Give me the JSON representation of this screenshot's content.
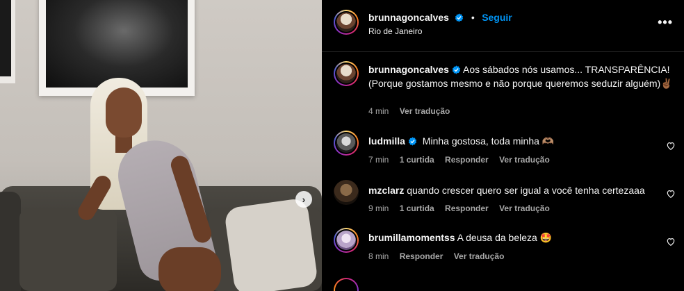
{
  "post": {
    "author": "brunnagoncalves",
    "follow_label": "Seguir",
    "separator": "•",
    "location": "Rio de Janeiro",
    "more_label": "•••",
    "next_label": "›"
  },
  "caption": {
    "author": "brunnagoncalves",
    "text": "Aos sábados nós usamos... TRANSPARÊNCIA! (Porque gostamos mesmo e não porque queremos seduzir alguém)✌🏾",
    "time": "4 min",
    "translate": "Ver tradução"
  },
  "comments": [
    {
      "author": "ludmilla",
      "verified": true,
      "text": "Minha gostosa, toda minha 🫶🏽",
      "time": "7 min",
      "likes": "1 curtida",
      "reply": "Responder",
      "translate": "Ver tradução"
    },
    {
      "author": "mzclarz",
      "verified": false,
      "text": "quando crescer quero ser igual a você tenha certezaaa",
      "time": "9 min",
      "likes": "1 curtida",
      "reply": "Responder",
      "translate": "Ver tradução"
    },
    {
      "author": "brumillamomentss",
      "verified": false,
      "text": "A deusa da beleza 🤩",
      "time": "8 min",
      "reply": "Responder",
      "translate": "Ver tradução"
    }
  ],
  "colors": {
    "background": "#000000",
    "text": "#f5f5f5",
    "muted": "#a8a8a8",
    "accent": "#0095f6"
  },
  "icons": [
    "verified-icon",
    "heart-icon",
    "more-icon",
    "chevron-right-icon"
  ]
}
